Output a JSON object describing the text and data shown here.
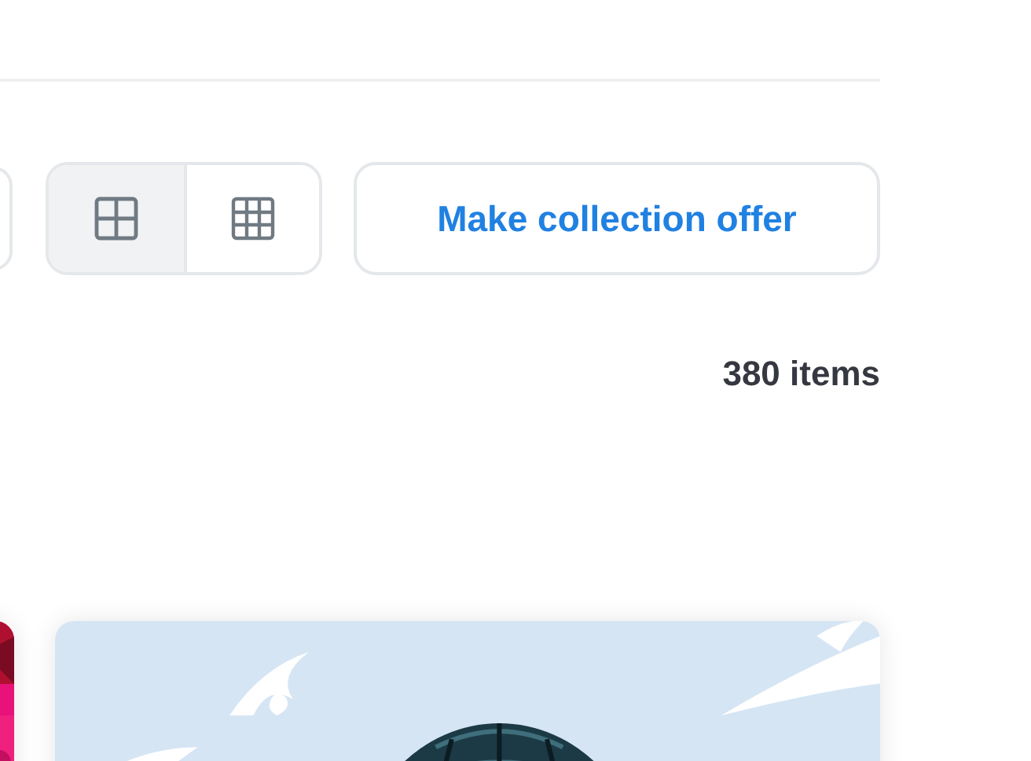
{
  "toolbar": {
    "view_options": [
      {
        "kind": "large-grid",
        "selected": true
      },
      {
        "kind": "small-grid",
        "selected": false
      }
    ],
    "offer_button": "Make collection offer"
  },
  "item_count": "380 items"
}
